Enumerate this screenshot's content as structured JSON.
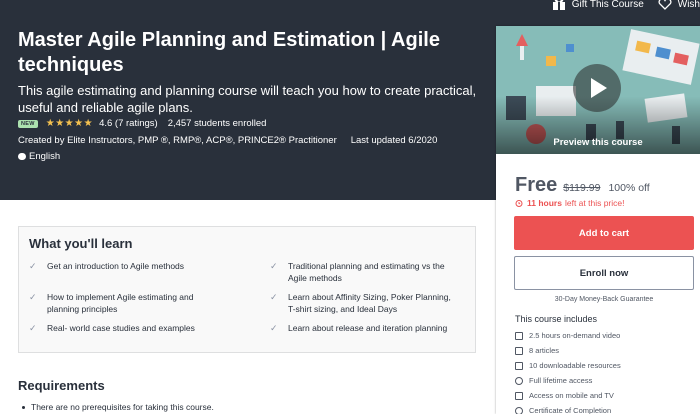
{
  "topbar": {
    "gift_label": "Gift This Course",
    "wishlist_label": "Wish"
  },
  "course": {
    "title": "Master Agile Planning and Estimation | Agile techniques",
    "subtitle": "This agile estimating and planning course will teach you how to create practical, useful and reliable agile plans.",
    "badge": "NEW",
    "stars": "★★★★★",
    "rating_text": "4.6 (7 ratings)",
    "students": "2,457 students enrolled",
    "created_by": "Created by Elite Instructors, PMP ®, RMP®, ACP®, PRINCE2® Practitioner",
    "last_updated": "Last updated 6/2020",
    "language": "English"
  },
  "sidebar": {
    "preview_label": "Preview this course",
    "price": "Free",
    "original_price": "$119.99",
    "discount": "100% off",
    "timer_hours": "11 hours",
    "timer_suffix": "left at this price!",
    "add_to_cart": "Add to cart",
    "enroll_now": "Enroll now",
    "guarantee": "30-Day Money-Back Guarantee",
    "includes_title": "This course includes",
    "includes": [
      {
        "icon": "video-icon",
        "text": "2.5 hours on-demand video"
      },
      {
        "icon": "article-icon",
        "text": "8 articles"
      },
      {
        "icon": "download-icon",
        "text": "10 downloadable resources"
      },
      {
        "icon": "infinity-icon",
        "text": "Full lifetime access"
      },
      {
        "icon": "mobile-icon",
        "text": "Access on mobile and TV"
      },
      {
        "icon": "certificate-icon",
        "text": "Certificate of Completion"
      }
    ]
  },
  "learn": {
    "title": "What you'll learn",
    "items": [
      "Get an introduction to Agile methods",
      "Traditional planning and estimating vs the Agile methods",
      "How to implement Agile estimating and planning principles",
      "Learn about Affinity Sizing, Poker Planning, T-shirt sizing, and Ideal Days",
      "Real- world case studies and examples",
      "Learn about release and iteration planning"
    ]
  },
  "requirements": {
    "title": "Requirements",
    "items": [
      "There are no prerequisites for taking this course."
    ]
  },
  "colors": {
    "hero_bg": "#29303b",
    "accent_red": "#ec5252",
    "star": "#f4c150",
    "badge_bg": "#ace1af"
  }
}
